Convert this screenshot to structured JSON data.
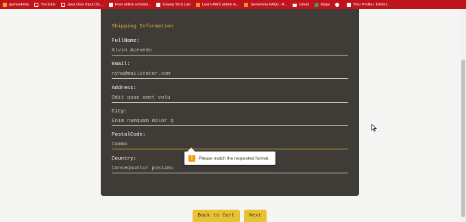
{
  "bookmarks": [
    {
      "label": "games4kids",
      "color": "#f2a92e"
    },
    {
      "label": "YouTube",
      "color": "#ff0000"
    },
    {
      "label": "Java User Input (Sc...",
      "color": "#ff0000"
    },
    {
      "label": "Free online schedul...",
      "color": "#ffffff"
    },
    {
      "label": "Ghana Tech Lab",
      "color": "#ffffff"
    },
    {
      "label": "Learn AWS online w...",
      "color": "#f0913a"
    },
    {
      "label": "Serverless FAQs - A...",
      "color": "#f0913a"
    },
    {
      "label": "Gmail",
      "color": "#ffffff"
    },
    {
      "label": "Maps",
      "color": "#34a853"
    },
    {
      "label": "",
      "color": "#ffffff"
    },
    {
      "label": "Your Profile | 16Pers...",
      "color": "#ffffff"
    }
  ],
  "form": {
    "section_title": "Shipping Information",
    "fields": [
      {
        "label": "FullName:",
        "value": "Alvin Acevedo"
      },
      {
        "label": "Email:",
        "value": "nyha@mailinator.com"
      },
      {
        "label": "Address:",
        "value": "Odit quae amet volu"
      },
      {
        "label": "City:",
        "value": "Enim numquam dolor q"
      },
      {
        "label": "PostalCode:",
        "value": "Commo"
      },
      {
        "label": "Country:",
        "value": "Consequuntur possimu"
      }
    ]
  },
  "tooltip": {
    "text": "Please match the requested format.",
    "icon": "!"
  },
  "buttons": {
    "back": "Back to Cart",
    "next": "Next"
  },
  "colors": {
    "accent": "#e2b93b",
    "card_bg": "#3f3b36",
    "button_bg": "#e9c233",
    "bar": "#c0141c"
  }
}
